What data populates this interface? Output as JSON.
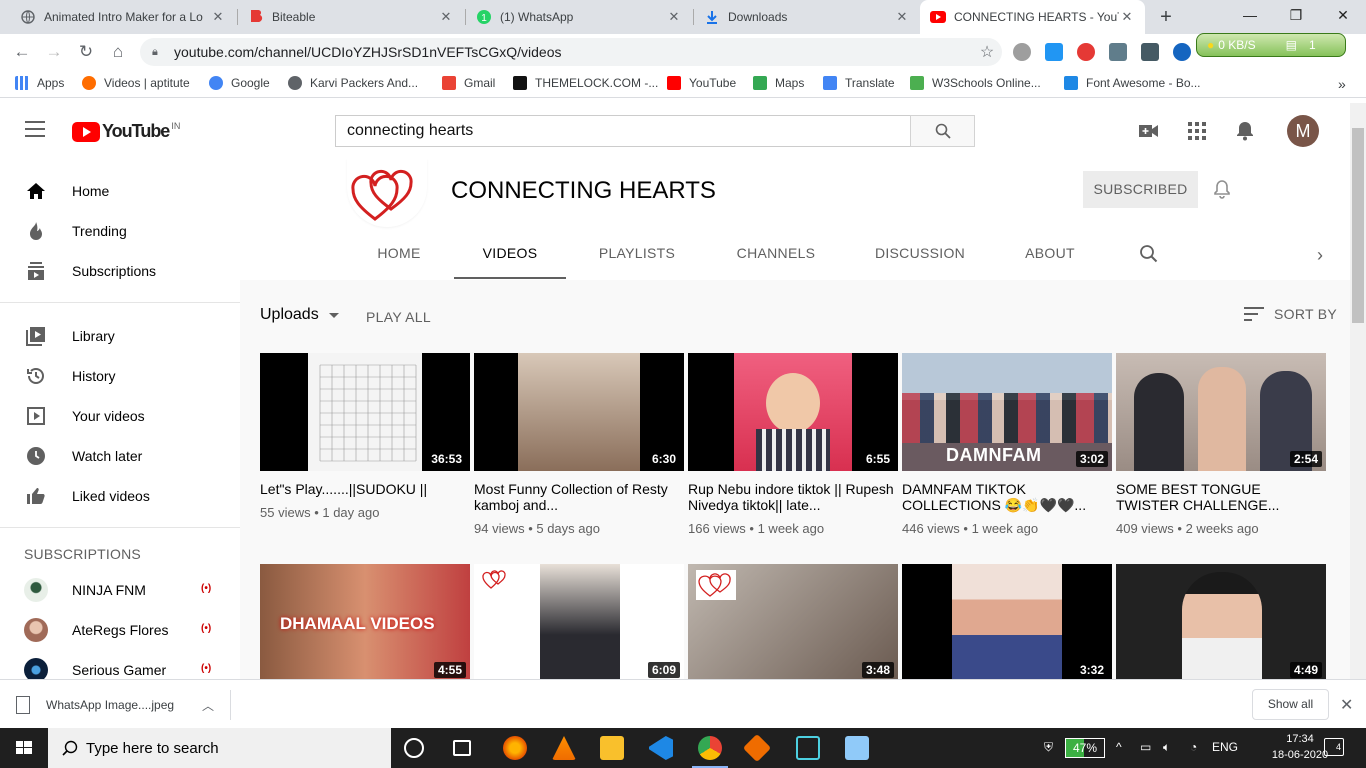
{
  "browser": {
    "tabs": [
      {
        "label": "Animated Intro Maker for a Lo",
        "icon": "globe-icon"
      },
      {
        "label": "Biteable",
        "icon": "biteable-icon"
      },
      {
        "label": "(1) WhatsApp",
        "icon": "whatsapp-icon"
      },
      {
        "label": "Downloads",
        "icon": "download-icon"
      },
      {
        "label": "CONNECTING HEARTS - YouTu",
        "icon": "youtube-icon",
        "active": true
      }
    ],
    "url": "youtube.com/channel/UCDIoYZHJSrSD1nVEFTsCGxQ/videos",
    "net_meter": {
      "speed": "0 KB/S",
      "count": "1"
    },
    "bookmarks": [
      {
        "label": "Apps",
        "color": "#4285f4"
      },
      {
        "label": "Videos | aptitute",
        "color": "#ff6d00"
      },
      {
        "label": "Google",
        "color": "#4285f4"
      },
      {
        "label": "Karvi Packers And...",
        "color": "#5f6368"
      },
      {
        "label": "Gmail",
        "color": "#ea4335"
      },
      {
        "label": "THEMELOCK.COM -...",
        "color": "#111111"
      },
      {
        "label": "YouTube",
        "color": "#ff0000"
      },
      {
        "label": "Maps",
        "color": "#34a853"
      },
      {
        "label": "Translate",
        "color": "#4285f4"
      },
      {
        "label": "W3Schools Online...",
        "color": "#4caf50"
      },
      {
        "label": "Font Awesome - Bo...",
        "color": "#1e88e5"
      }
    ]
  },
  "youtube": {
    "logo_text": "YouTube",
    "country": "IN",
    "search_value": "connecting hearts",
    "avatar_letter": "M",
    "sidebar": {
      "main": [
        {
          "label": "Home",
          "icon": "home-icon"
        },
        {
          "label": "Trending",
          "icon": "flame-icon"
        },
        {
          "label": "Subscriptions",
          "icon": "subscriptions-icon"
        }
      ],
      "library": [
        {
          "label": "Library",
          "icon": "library-icon"
        },
        {
          "label": "History",
          "icon": "history-icon"
        },
        {
          "label": "Your videos",
          "icon": "your-videos-icon"
        },
        {
          "label": "Watch later",
          "icon": "clock-icon"
        },
        {
          "label": "Liked videos",
          "icon": "thumbs-up-icon"
        }
      ],
      "subscriptions_heading": "SUBSCRIPTIONS",
      "subscriptions": [
        {
          "label": "NINJA FNM",
          "color": "#3a6b4a"
        },
        {
          "label": "AteRegs Flores",
          "color": "#c9a28c"
        },
        {
          "label": "Serious Gamer",
          "color": "#1a3a6a"
        }
      ]
    },
    "channel": {
      "name": "CONNECTING HEARTS",
      "subscribe_label": "SUBSCRIBED",
      "tabs": [
        "HOME",
        "VIDEOS",
        "PLAYLISTS",
        "CHANNELS",
        "DISCUSSION",
        "ABOUT"
      ],
      "active_tab": "VIDEOS",
      "uploads_label": "Uploads",
      "play_all": "PLAY ALL",
      "sort_by": "SORT BY",
      "videos": [
        {
          "title": "Let\"s Play.......||SUDOKU ||",
          "views": "55 views",
          "age": "1 day ago",
          "duration": "36:53",
          "thumb": "#f4f4f4"
        },
        {
          "title": "Most Funny Collection of Resty kamboj and...",
          "views": "94 views",
          "age": "5 days ago",
          "duration": "6:30",
          "thumb": "#b89c86"
        },
        {
          "title": "Rup Nebu indore tiktok || Rupesh Nivedya tiktok|| late...",
          "views": "166 views",
          "age": "1 week ago",
          "duration": "6:55",
          "thumb": "#e64a63"
        },
        {
          "title": "DAMNFAM TIKTOK COLLECTIONS 😂👏🖤🖤...",
          "views": "446 views",
          "age": "1 week ago",
          "duration": "3:02",
          "thumb": "#8aa0b8"
        },
        {
          "title": "SOME BEST TONGUE TWISTER CHALLENGE...",
          "views": "409 views",
          "age": "2 weeks ago",
          "duration": "2:54",
          "thumb": "#b0a59c"
        },
        {
          "title": "",
          "views": "",
          "age": "",
          "duration": "4:55",
          "thumb": "#c0563c",
          "overlay": "DHAMAAL VIDEOS"
        },
        {
          "title": "",
          "views": "",
          "age": "",
          "duration": "6:09",
          "thumb": "#e8e0dc"
        },
        {
          "title": "",
          "views": "",
          "age": "",
          "duration": "3:48",
          "thumb": "#8a7868"
        },
        {
          "title": "",
          "views": "",
          "age": "",
          "duration": "3:32",
          "thumb": "#d8b0a0"
        },
        {
          "title": "",
          "views": "",
          "age": "",
          "duration": "4:49",
          "thumb": "#3a3a3a"
        }
      ]
    }
  },
  "download": {
    "file": "WhatsApp Image....jpeg",
    "show_all": "Show all"
  },
  "taskbar": {
    "search_placeholder": "Type here to search",
    "battery": "47%",
    "lang": "ENG",
    "time": "17:34",
    "date": "18-06-2020",
    "notifications": "4"
  }
}
